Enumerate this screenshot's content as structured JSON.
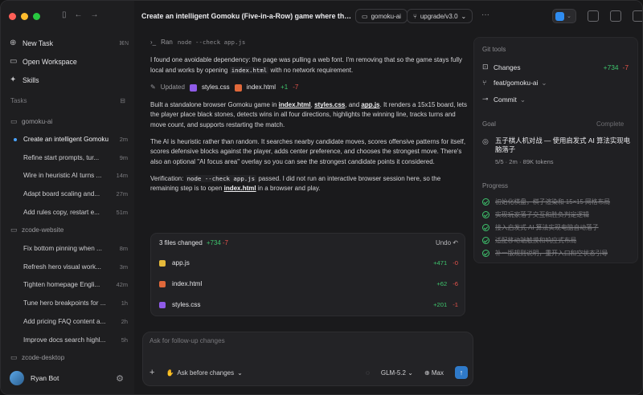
{
  "sidebar": {
    "nav": [
      {
        "label": "New Task",
        "icon": "new-task-icon",
        "shortcut": "⌘N"
      },
      {
        "label": "Open Workspace",
        "icon": "folder-icon"
      },
      {
        "label": "Skills",
        "icon": "skills-icon"
      }
    ],
    "tasks_label": "Tasks",
    "groups": [
      {
        "name": "gomoku-ai",
        "tasks": [
          {
            "title": "Create an intelligent Gomoku",
            "age": "2m",
            "active": true
          },
          {
            "title": "Refine start prompts, tur...",
            "age": "9m"
          },
          {
            "title": "Wire in heuristic AI turns ...",
            "age": "14m"
          },
          {
            "title": "Adapt board scaling and...",
            "age": "27m"
          },
          {
            "title": "Add rules copy, restart e...",
            "age": "51m"
          }
        ]
      },
      {
        "name": "zcode-website",
        "tasks": [
          {
            "title": "Fix bottom pinning when ...",
            "age": "8m"
          },
          {
            "title": "Refresh hero visual work...",
            "age": "3m"
          },
          {
            "title": "Tighten homepage Engli...",
            "age": "42m"
          },
          {
            "title": "Tune hero breakpoints for ...",
            "age": "1h"
          },
          {
            "title": "Add pricing FAQ content a...",
            "age": "2h"
          },
          {
            "title": "Improve docs search highl...",
            "age": "5h"
          }
        ]
      },
      {
        "name": "zcode-desktop",
        "tasks": []
      }
    ],
    "user": {
      "name": "Ryan Bot"
    }
  },
  "header": {
    "title": "Create an intelligent Gomoku (Five-in-a-Row) game where the ...",
    "repo": "gomoku-ai",
    "branch": "upgrade/v3.0",
    "more": "···"
  },
  "conversation": {
    "ran_label": "Ran",
    "ran_cmd": "node --check app.js",
    "p1a": "I found one avoidable dependency: the page was pulling a web font. I'm removing that so the game stays fully local and works by opening ",
    "p1code": "index.html",
    "p1b": " with no network requirement.",
    "updated_label": "Updated",
    "updated_files": [
      {
        "name": "styles.css",
        "color": "#8f5be8"
      },
      {
        "name": "index.html",
        "color": "#e0683a"
      }
    ],
    "updated_plus": "+1",
    "updated_minus": "-7",
    "p2a": "Built a standalone browser Gomoku game in ",
    "p2l1": "index.html",
    "p2s1": ", ",
    "p2l2": "styles.css",
    "p2s2": ", and ",
    "p2l3": "app.js",
    "p2b": ". It renders a 15x15 board, lets the player place black stones, detects wins in all four directions, highlights the winning line, tracks turns and move count, and supports restarting the match.",
    "p3": "The AI is heuristic rather than random. It searches nearby candidate moves, scores offensive patterns for itself, scores defensive blocks against the player, adds center preference, and chooses the strongest move. There's also an optional \"AI focus area\" overlay so you can see the strongest candidate points it considered.",
    "p4a": "Verification: ",
    "p4code": "node --check app.js",
    "p4b": " passed. I did not run an interactive browser session here, so the remaining step is to open ",
    "p4link": "index.html",
    "p4c": " in a browser and play."
  },
  "files_changed": {
    "label": "3 files changed",
    "plus": "+734",
    "minus": "-7",
    "undo": "Undo",
    "files": [
      {
        "name": "app.js",
        "plus": "+471",
        "minus": "-0",
        "color": "#e5b93a"
      },
      {
        "name": "index.html",
        "plus": "+62",
        "minus": "-6",
        "color": "#e0683a"
      },
      {
        "name": "styles.css",
        "plus": "+201",
        "minus": "-1",
        "color": "#8f5be8"
      }
    ]
  },
  "composer": {
    "placeholder": "Ask for follow-up changes",
    "mode": "Ask before changes",
    "model": "GLM-5.2",
    "effort": "Max"
  },
  "panel": {
    "git_label": "Git tools",
    "changes_label": "Changes",
    "changes_plus": "+734",
    "changes_minus": "-7",
    "branch": "feat/gomoku-ai",
    "commit": "Commit",
    "goal_label": "Goal",
    "goal_status": "Complete",
    "goal_text": "五子棋人机对战 — 使用启发式 AI 算法实现电脑落子",
    "goal_meta": "5/5 · 2m · 89K tokens",
    "progress_label": "Progress",
    "progress": [
      "初始化棋盘，棋子渲染和 15×15 网格布局",
      "实现玩家落子交互和胜负判定逻辑",
      "接入启发式 AI 算法实现电脑自动落子",
      "适配移动端触摸和响应式布局",
      "补一版规则说明，重开入口和空状态引导"
    ]
  },
  "colors": {
    "accent": "#2f8cf0",
    "add": "#3ec46d",
    "del": "#e5534b"
  }
}
